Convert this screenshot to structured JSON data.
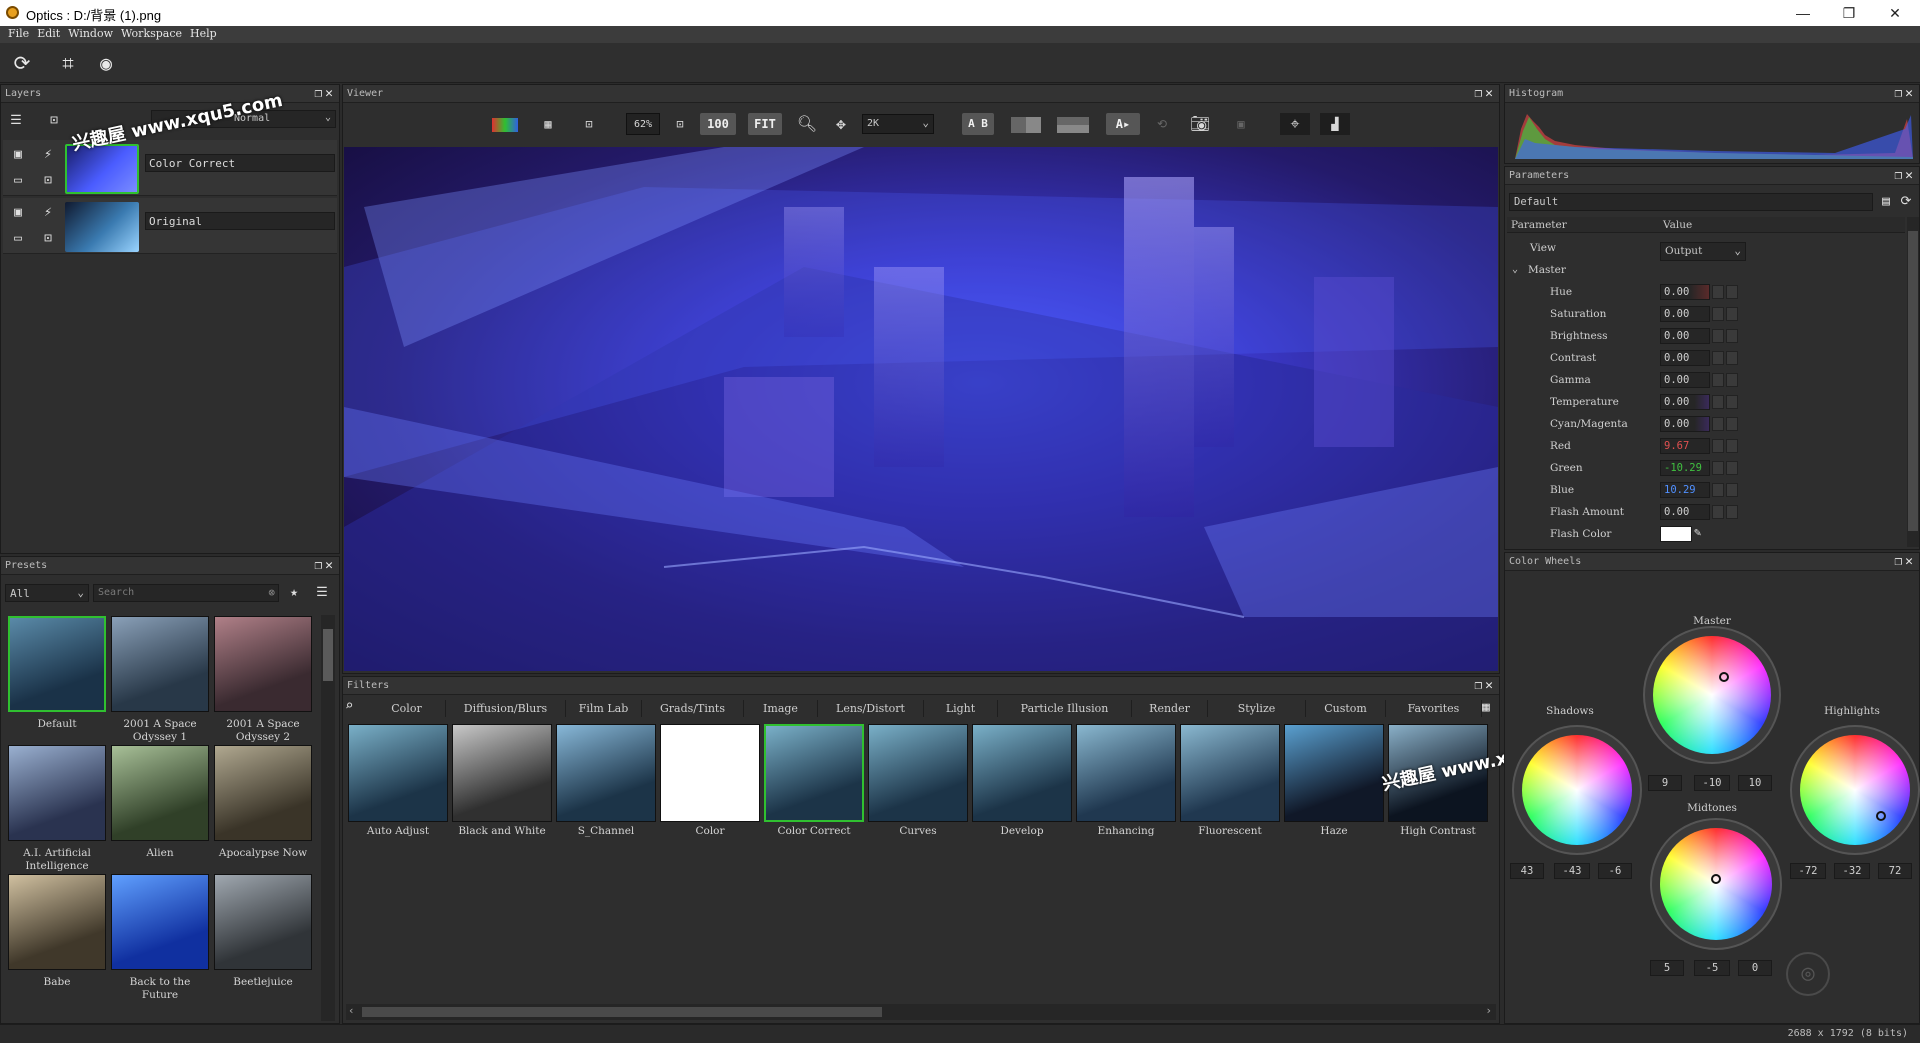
{
  "window": {
    "title": "Optics : D:/背景 (1).png",
    "minimize": "—",
    "maximize": "❐",
    "close": "✕"
  },
  "menu": [
    "File",
    "Edit",
    "Window",
    "Workspace",
    "Help"
  ],
  "layers": {
    "title": "Layers",
    "blend_mode": "Normal",
    "items": [
      {
        "name": "Color Correct"
      },
      {
        "name": "Original"
      }
    ]
  },
  "viewer": {
    "title": "Viewer",
    "zoom": "62%",
    "btn_100": "100",
    "btn_fit": "FIT",
    "resolution": "2K",
    "ab_label": "A B"
  },
  "histogram": {
    "title": "Histogram"
  },
  "parameters": {
    "title": "Parameters",
    "preset": "Default",
    "col_param": "Parameter",
    "col_value": "Value",
    "view_label": "View",
    "view_value": "Output",
    "group": "Master",
    "rows": [
      {
        "label": "Hue",
        "value": "0.00"
      },
      {
        "label": "Saturation",
        "value": "0.00"
      },
      {
        "label": "Brightness",
        "value": "0.00"
      },
      {
        "label": "Contrast",
        "value": "0.00"
      },
      {
        "label": "Gamma",
        "value": "0.00"
      },
      {
        "label": "Temperature",
        "value": "0.00"
      },
      {
        "label": "Cyan/Magenta",
        "value": "0.00"
      },
      {
        "label": "Red",
        "value": "9.67"
      },
      {
        "label": "Green",
        "value": "-10.29"
      },
      {
        "label": "Blue",
        "value": "10.29"
      },
      {
        "label": "Flash Amount",
        "value": "0.00"
      },
      {
        "label": "Flash Color",
        "value": ""
      }
    ]
  },
  "color_wheels": {
    "title": "Color Wheels",
    "master": {
      "label": "Master",
      "values": [
        "9",
        "-10",
        "10"
      ]
    },
    "shadows": {
      "label": "Shadows",
      "values": [
        "43",
        "-43",
        "-6"
      ]
    },
    "highlights": {
      "label": "Highlights",
      "values": [
        "-72",
        "-32",
        "72"
      ]
    },
    "midtones": {
      "label": "Midtones",
      "values": [
        "5",
        "-5",
        "0"
      ]
    }
  },
  "presets": {
    "title": "Presets",
    "category": "All",
    "search_placeholder": "Search",
    "items": [
      [
        "Default"
      ],
      [
        "2001 A Space",
        "Odyssey 1"
      ],
      [
        "2001 A Space",
        "Odyssey 2"
      ],
      [
        "A.I. Artificial",
        "Intelligence"
      ],
      [
        "Alien"
      ],
      [
        "Apocalypse Now"
      ],
      [
        "Babe"
      ],
      [
        "Back to the",
        "Future"
      ],
      [
        "Beetlejuice"
      ]
    ]
  },
  "filters": {
    "title": "Filters",
    "tabs": [
      "Color",
      "Diffusion/Blurs",
      "Film Lab",
      "Grads/Tints",
      "Image",
      "Lens/Distort",
      "Light",
      "Particle Illusion",
      "Render",
      "Stylize",
      "Custom",
      "Favorites"
    ],
    "items": [
      "Auto Adjust",
      "Black and White",
      "S_Channel",
      "Color",
      "Color Correct",
      "Curves",
      "Develop",
      "Enhancing",
      "Fluorescent",
      "Haze",
      "High Contrast"
    ]
  },
  "status": {
    "dimensions": "2688 x 1792 (8 bits)"
  },
  "watermark": "兴趣屋 www.xqu5.com",
  "colors": {
    "selection_green": "#30c030",
    "red_value": "#e05050",
    "green_value": "#40c040",
    "blue_value": "#5090ff"
  }
}
